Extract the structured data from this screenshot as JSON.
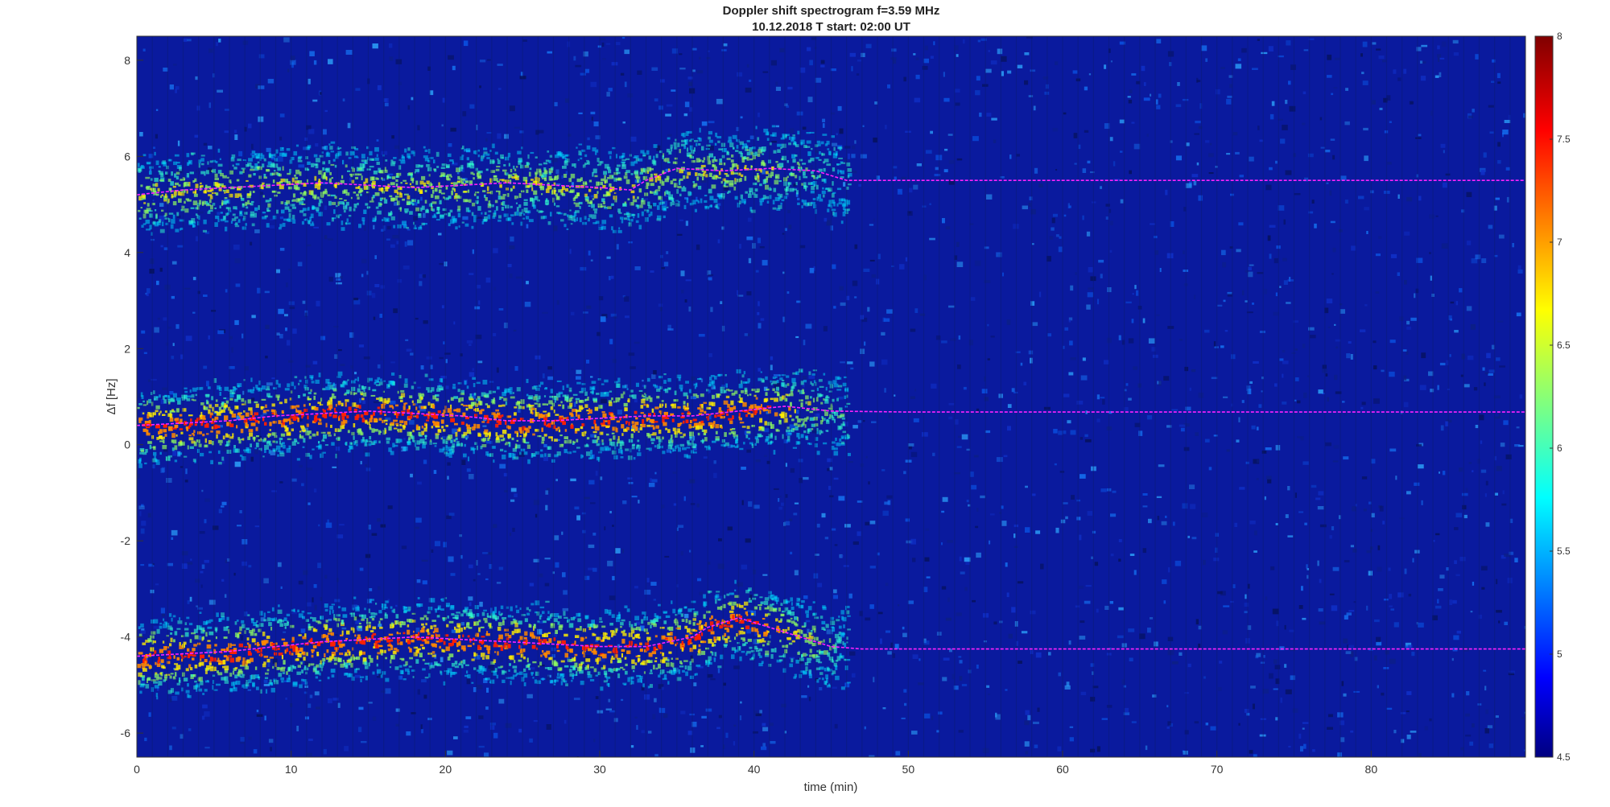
{
  "chart_data": {
    "type": "heatmap",
    "title": "Doppler shift spectrogram f=3.59 MHz",
    "subtitle": "10.12.2018   T start: 02:00 UT",
    "xlabel": "time (min)",
    "ylabel": "Δf [Hz]",
    "xlim": [
      0,
      90
    ],
    "ylim": [
      -6.5,
      8.5
    ],
    "xticks": [
      0,
      10,
      20,
      30,
      40,
      50,
      60,
      70,
      80
    ],
    "yticks": [
      -6,
      -4,
      -2,
      0,
      2,
      4,
      6,
      8
    ],
    "colorbar": {
      "range": [
        4.5,
        8
      ],
      "ticks": [
        4.5,
        5,
        5.5,
        6,
        6.5,
        7,
        7.5,
        8
      ],
      "colormap": "jet"
    },
    "grid": false,
    "trace_color": "#ff22ff",
    "series": [
      {
        "x": [
          0,
          3,
          6,
          9,
          12,
          15,
          18,
          21,
          24,
          27,
          30,
          32,
          33,
          35,
          38,
          41,
          44,
          46,
          50,
          90
        ],
        "y": [
          5.2,
          5.3,
          5.35,
          5.4,
          5.45,
          5.4,
          5.35,
          5.4,
          5.45,
          5.4,
          5.35,
          5.3,
          5.5,
          5.75,
          5.7,
          5.75,
          5.7,
          5.5,
          5.5,
          5.5
        ]
      },
      {
        "x": [
          0,
          3,
          6,
          9,
          12,
          15,
          18,
          21,
          24,
          27,
          30,
          33,
          36,
          39,
          42,
          45,
          50,
          90
        ],
        "y": [
          0.4,
          0.45,
          0.5,
          0.6,
          0.65,
          0.7,
          0.65,
          0.6,
          0.5,
          0.5,
          0.55,
          0.6,
          0.6,
          0.7,
          0.8,
          0.7,
          0.68,
          0.68
        ]
      },
      {
        "x": [
          0,
          3,
          6,
          9,
          12,
          15,
          18,
          21,
          24,
          27,
          30,
          33,
          36,
          37,
          39,
          41,
          43,
          45,
          47,
          50,
          90
        ],
        "y": [
          -4.4,
          -4.35,
          -4.3,
          -4.2,
          -4.1,
          -4.05,
          -4.0,
          -4.05,
          -4.1,
          -4.15,
          -4.2,
          -4.2,
          -4.0,
          -3.8,
          -3.6,
          -3.8,
          -4.0,
          -4.2,
          -4.25,
          -4.25,
          -4.25
        ]
      }
    ]
  }
}
